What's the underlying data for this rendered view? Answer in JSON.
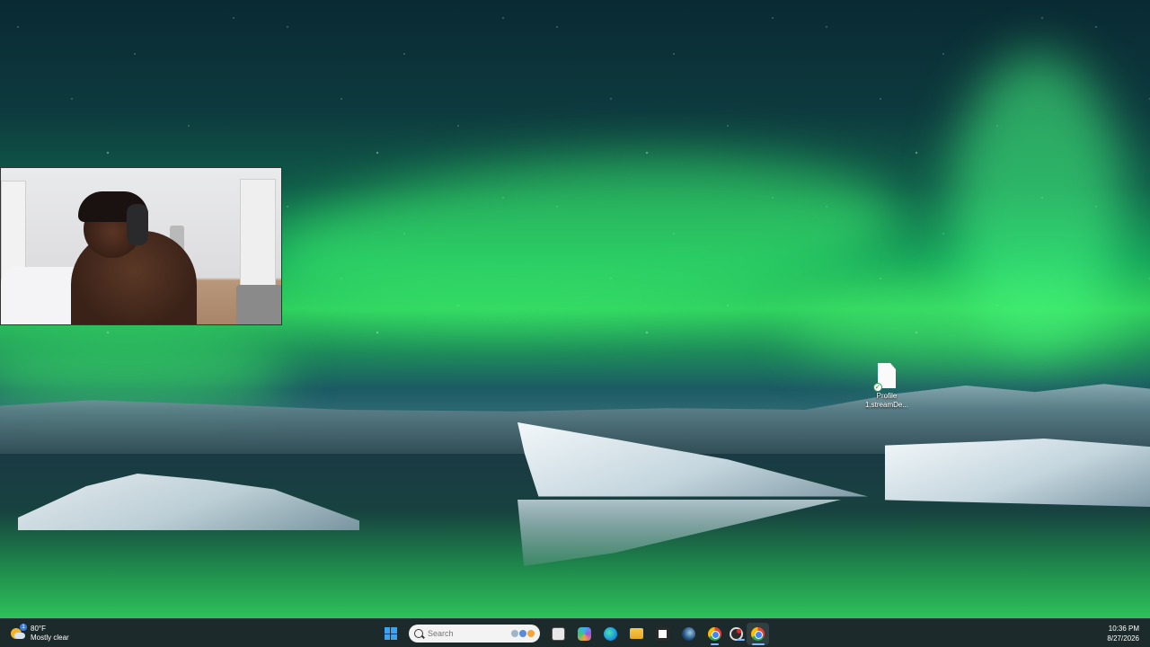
{
  "desktop": {
    "icons": [
      {
        "label": "Profile\n1.streamDe..."
      }
    ]
  },
  "webcam": {},
  "taskbar": {
    "weather": {
      "temp": "80°F",
      "condition": "Mostly clear",
      "badge": "1"
    },
    "search": {
      "placeholder": "Search"
    },
    "pinned": [
      "start-icon",
      "search",
      "task-view-icon",
      "copilot-icon",
      "edge-icon",
      "file-explorer-icon",
      "microsoft-store-icon",
      "steam-icon",
      "chrome-icon",
      "obs-icon",
      "chrome-icon"
    ],
    "clock": {
      "time": "10:36 PM",
      "date": "8/27/2026"
    }
  },
  "colors": {
    "accent": "#3ea2f2",
    "taskbar": "#1c2a2c",
    "aurora": "#2fcf5e"
  }
}
